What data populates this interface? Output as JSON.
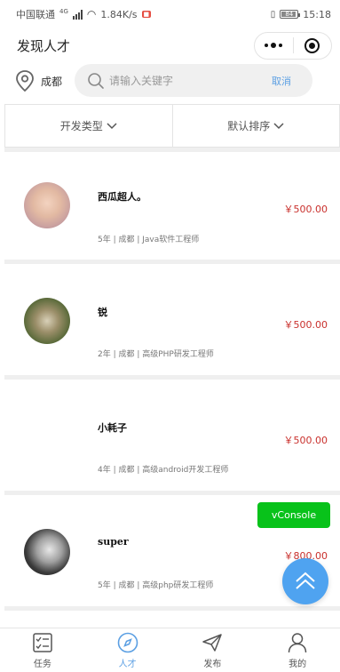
{
  "status": {
    "carrier": "中国联通",
    "network": "4G",
    "speed": "1.84K/s",
    "battery": "84",
    "time": "15:18"
  },
  "nav": {
    "title": "发现人才"
  },
  "search": {
    "city": "成都",
    "placeholder": "请输入关键字",
    "cancel": "取消"
  },
  "filters": {
    "type": "开发类型",
    "sort": "默认排序"
  },
  "talents": [
    {
      "name": "西瓜超人。",
      "price": "￥500.00",
      "meta": "5年 | 成都 | Java软件工程师"
    },
    {
      "name": "锐",
      "price": "￥500.00",
      "meta": "2年 | 成都 | 高级PHP研发工程师"
    },
    {
      "name": "小耗子",
      "price": "￥500.00",
      "meta": "4年 | 成都 | 高级android开发工程师"
    },
    {
      "name": "super",
      "price": "￥800.00",
      "meta": "5年 | 成都 | 高级php研发工程师"
    }
  ],
  "vconsole": "vConsole",
  "tabs": [
    {
      "label": "任务",
      "icon": "task-list-icon"
    },
    {
      "label": "人才",
      "icon": "compass-icon"
    },
    {
      "label": "发布",
      "icon": "send-icon"
    },
    {
      "label": "我的",
      "icon": "person-icon"
    }
  ],
  "colors": {
    "accent": "#5b9fe3",
    "price": "#c9302c",
    "vconsole": "#08c21a",
    "fab": "#4fa3f0"
  }
}
